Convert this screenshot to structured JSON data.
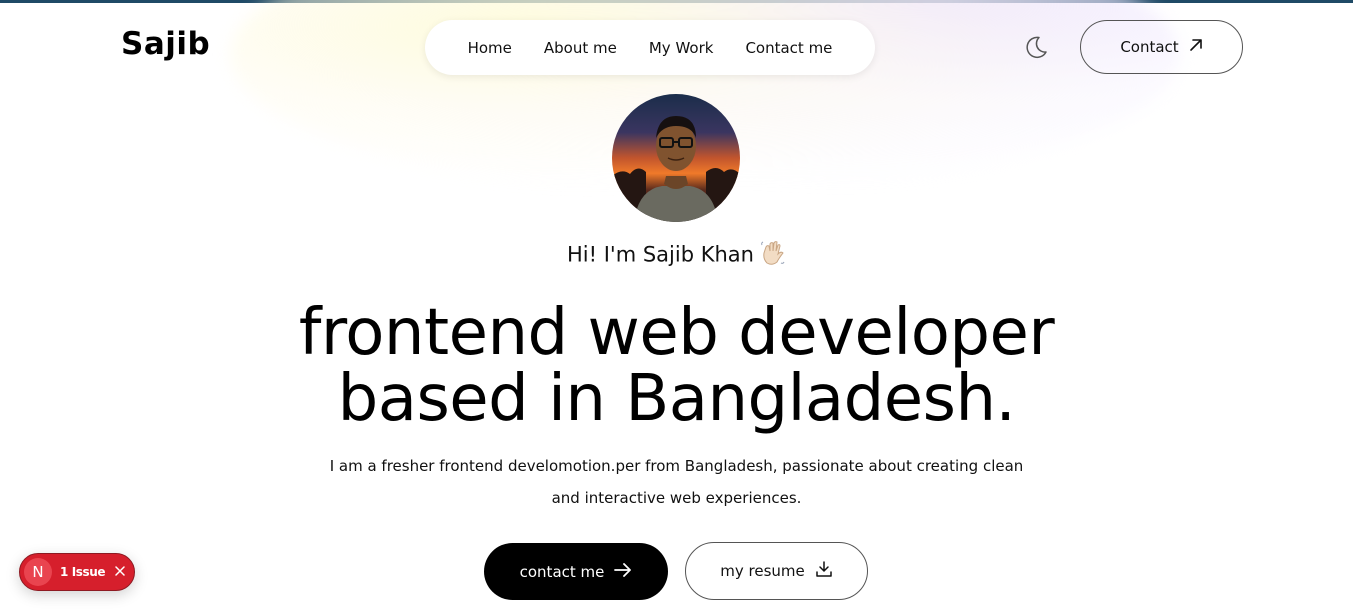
{
  "brand": {
    "logo_text": "Sajib"
  },
  "nav": {
    "items": [
      {
        "label": "Home"
      },
      {
        "label": "About me"
      },
      {
        "label": "My Work"
      },
      {
        "label": "Contact me"
      }
    ]
  },
  "header": {
    "theme_icon": "moon-icon",
    "contact_label": "Contact",
    "contact_icon": "arrow-up-right-icon"
  },
  "hero": {
    "avatar_icon": "profile-photo",
    "greeting": "Hi! I'm Sajib Khan",
    "greeting_emoji": "👋🏻",
    "headline_line1": "frontend web developer",
    "headline_line2": "based in Bangladesh.",
    "description": "I am a fresher frontend develomotion.per from Bangladesh, passionate about creating clean and interactive web experiences.",
    "primary_button": {
      "label": "contact me",
      "icon": "arrow-right-icon"
    },
    "secondary_button": {
      "label": "my resume",
      "icon": "download-icon"
    }
  },
  "dev_overlay": {
    "badge_letter": "N",
    "issues_label": "1 Issue",
    "close_icon": "close-icon"
  },
  "colors": {
    "top_border": "#1f4a66",
    "primary_button_bg": "#000000",
    "issue_badge_bg": "#d61f2c"
  }
}
